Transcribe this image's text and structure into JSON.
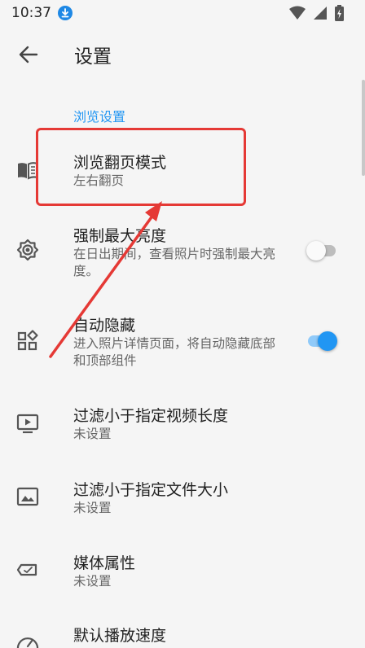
{
  "status_bar": {
    "time": "10:37"
  },
  "header": {
    "title": "设置"
  },
  "section": {
    "title": "浏览设置"
  },
  "preferences": [
    {
      "title": "浏览翻页模式",
      "summary": "左右翻页",
      "icon": "book-open-icon"
    },
    {
      "title": "强制最大亮度",
      "summary": "在日出期间，查看照片时强制最大亮度。",
      "icon": "brightness-gear-icon",
      "switch": false
    },
    {
      "title": "自动隐藏",
      "summary": "进入照片详情页面，将自动隐藏底部和顶部组件",
      "icon": "widgets-icon",
      "switch": true
    },
    {
      "title": "过滤小于指定视频长度",
      "summary": "未设置",
      "icon": "video-screen-icon"
    },
    {
      "title": "过滤小于指定文件大小",
      "summary": "未设置",
      "icon": "image-frame-icon"
    },
    {
      "title": "媒体属性",
      "summary": "未设置",
      "icon": "tag-icon"
    },
    {
      "title": "默认播放速度",
      "icon": "speedometer-icon"
    }
  ],
  "colors": {
    "accent": "#2196f3",
    "annotation": "#e53935",
    "background": "#f5f5f5"
  }
}
